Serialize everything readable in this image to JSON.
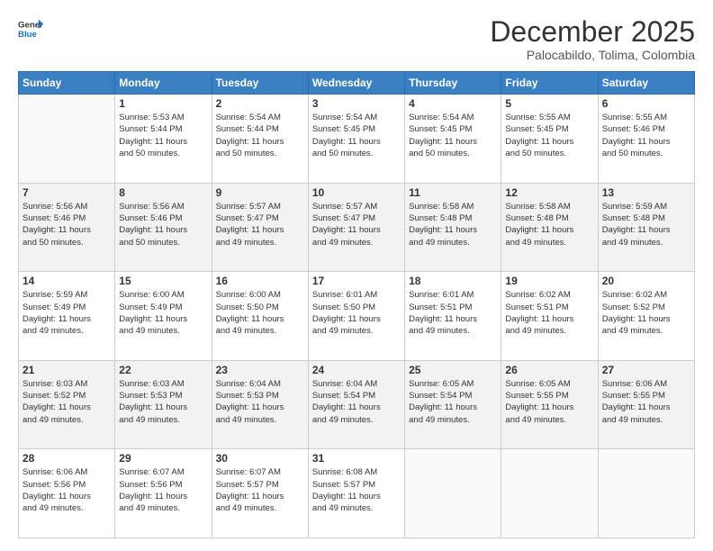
{
  "header": {
    "logo_line1": "General",
    "logo_line2": "Blue",
    "month": "December 2025",
    "location": "Palocabildo, Tolima, Colombia"
  },
  "days_of_week": [
    "Sunday",
    "Monday",
    "Tuesday",
    "Wednesday",
    "Thursday",
    "Friday",
    "Saturday"
  ],
  "weeks": [
    [
      {
        "day": "",
        "info": ""
      },
      {
        "day": "1",
        "info": "Sunrise: 5:53 AM\nSunset: 5:44 PM\nDaylight: 11 hours\nand 50 minutes."
      },
      {
        "day": "2",
        "info": "Sunrise: 5:54 AM\nSunset: 5:44 PM\nDaylight: 11 hours\nand 50 minutes."
      },
      {
        "day": "3",
        "info": "Sunrise: 5:54 AM\nSunset: 5:45 PM\nDaylight: 11 hours\nand 50 minutes."
      },
      {
        "day": "4",
        "info": "Sunrise: 5:54 AM\nSunset: 5:45 PM\nDaylight: 11 hours\nand 50 minutes."
      },
      {
        "day": "5",
        "info": "Sunrise: 5:55 AM\nSunset: 5:45 PM\nDaylight: 11 hours\nand 50 minutes."
      },
      {
        "day": "6",
        "info": "Sunrise: 5:55 AM\nSunset: 5:46 PM\nDaylight: 11 hours\nand 50 minutes."
      }
    ],
    [
      {
        "day": "7",
        "info": "Sunrise: 5:56 AM\nSunset: 5:46 PM\nDaylight: 11 hours\nand 50 minutes."
      },
      {
        "day": "8",
        "info": "Sunrise: 5:56 AM\nSunset: 5:46 PM\nDaylight: 11 hours\nand 50 minutes."
      },
      {
        "day": "9",
        "info": "Sunrise: 5:57 AM\nSunset: 5:47 PM\nDaylight: 11 hours\nand 49 minutes."
      },
      {
        "day": "10",
        "info": "Sunrise: 5:57 AM\nSunset: 5:47 PM\nDaylight: 11 hours\nand 49 minutes."
      },
      {
        "day": "11",
        "info": "Sunrise: 5:58 AM\nSunset: 5:48 PM\nDaylight: 11 hours\nand 49 minutes."
      },
      {
        "day": "12",
        "info": "Sunrise: 5:58 AM\nSunset: 5:48 PM\nDaylight: 11 hours\nand 49 minutes."
      },
      {
        "day": "13",
        "info": "Sunrise: 5:59 AM\nSunset: 5:48 PM\nDaylight: 11 hours\nand 49 minutes."
      }
    ],
    [
      {
        "day": "14",
        "info": "Sunrise: 5:59 AM\nSunset: 5:49 PM\nDaylight: 11 hours\nand 49 minutes."
      },
      {
        "day": "15",
        "info": "Sunrise: 6:00 AM\nSunset: 5:49 PM\nDaylight: 11 hours\nand 49 minutes."
      },
      {
        "day": "16",
        "info": "Sunrise: 6:00 AM\nSunset: 5:50 PM\nDaylight: 11 hours\nand 49 minutes."
      },
      {
        "day": "17",
        "info": "Sunrise: 6:01 AM\nSunset: 5:50 PM\nDaylight: 11 hours\nand 49 minutes."
      },
      {
        "day": "18",
        "info": "Sunrise: 6:01 AM\nSunset: 5:51 PM\nDaylight: 11 hours\nand 49 minutes."
      },
      {
        "day": "19",
        "info": "Sunrise: 6:02 AM\nSunset: 5:51 PM\nDaylight: 11 hours\nand 49 minutes."
      },
      {
        "day": "20",
        "info": "Sunrise: 6:02 AM\nSunset: 5:52 PM\nDaylight: 11 hours\nand 49 minutes."
      }
    ],
    [
      {
        "day": "21",
        "info": "Sunrise: 6:03 AM\nSunset: 5:52 PM\nDaylight: 11 hours\nand 49 minutes."
      },
      {
        "day": "22",
        "info": "Sunrise: 6:03 AM\nSunset: 5:53 PM\nDaylight: 11 hours\nand 49 minutes."
      },
      {
        "day": "23",
        "info": "Sunrise: 6:04 AM\nSunset: 5:53 PM\nDaylight: 11 hours\nand 49 minutes."
      },
      {
        "day": "24",
        "info": "Sunrise: 6:04 AM\nSunset: 5:54 PM\nDaylight: 11 hours\nand 49 minutes."
      },
      {
        "day": "25",
        "info": "Sunrise: 6:05 AM\nSunset: 5:54 PM\nDaylight: 11 hours\nand 49 minutes."
      },
      {
        "day": "26",
        "info": "Sunrise: 6:05 AM\nSunset: 5:55 PM\nDaylight: 11 hours\nand 49 minutes."
      },
      {
        "day": "27",
        "info": "Sunrise: 6:06 AM\nSunset: 5:55 PM\nDaylight: 11 hours\nand 49 minutes."
      }
    ],
    [
      {
        "day": "28",
        "info": "Sunrise: 6:06 AM\nSunset: 5:56 PM\nDaylight: 11 hours\nand 49 minutes."
      },
      {
        "day": "29",
        "info": "Sunrise: 6:07 AM\nSunset: 5:56 PM\nDaylight: 11 hours\nand 49 minutes."
      },
      {
        "day": "30",
        "info": "Sunrise: 6:07 AM\nSunset: 5:57 PM\nDaylight: 11 hours\nand 49 minutes."
      },
      {
        "day": "31",
        "info": "Sunrise: 6:08 AM\nSunset: 5:57 PM\nDaylight: 11 hours\nand 49 minutes."
      },
      {
        "day": "",
        "info": ""
      },
      {
        "day": "",
        "info": ""
      },
      {
        "day": "",
        "info": ""
      }
    ]
  ]
}
